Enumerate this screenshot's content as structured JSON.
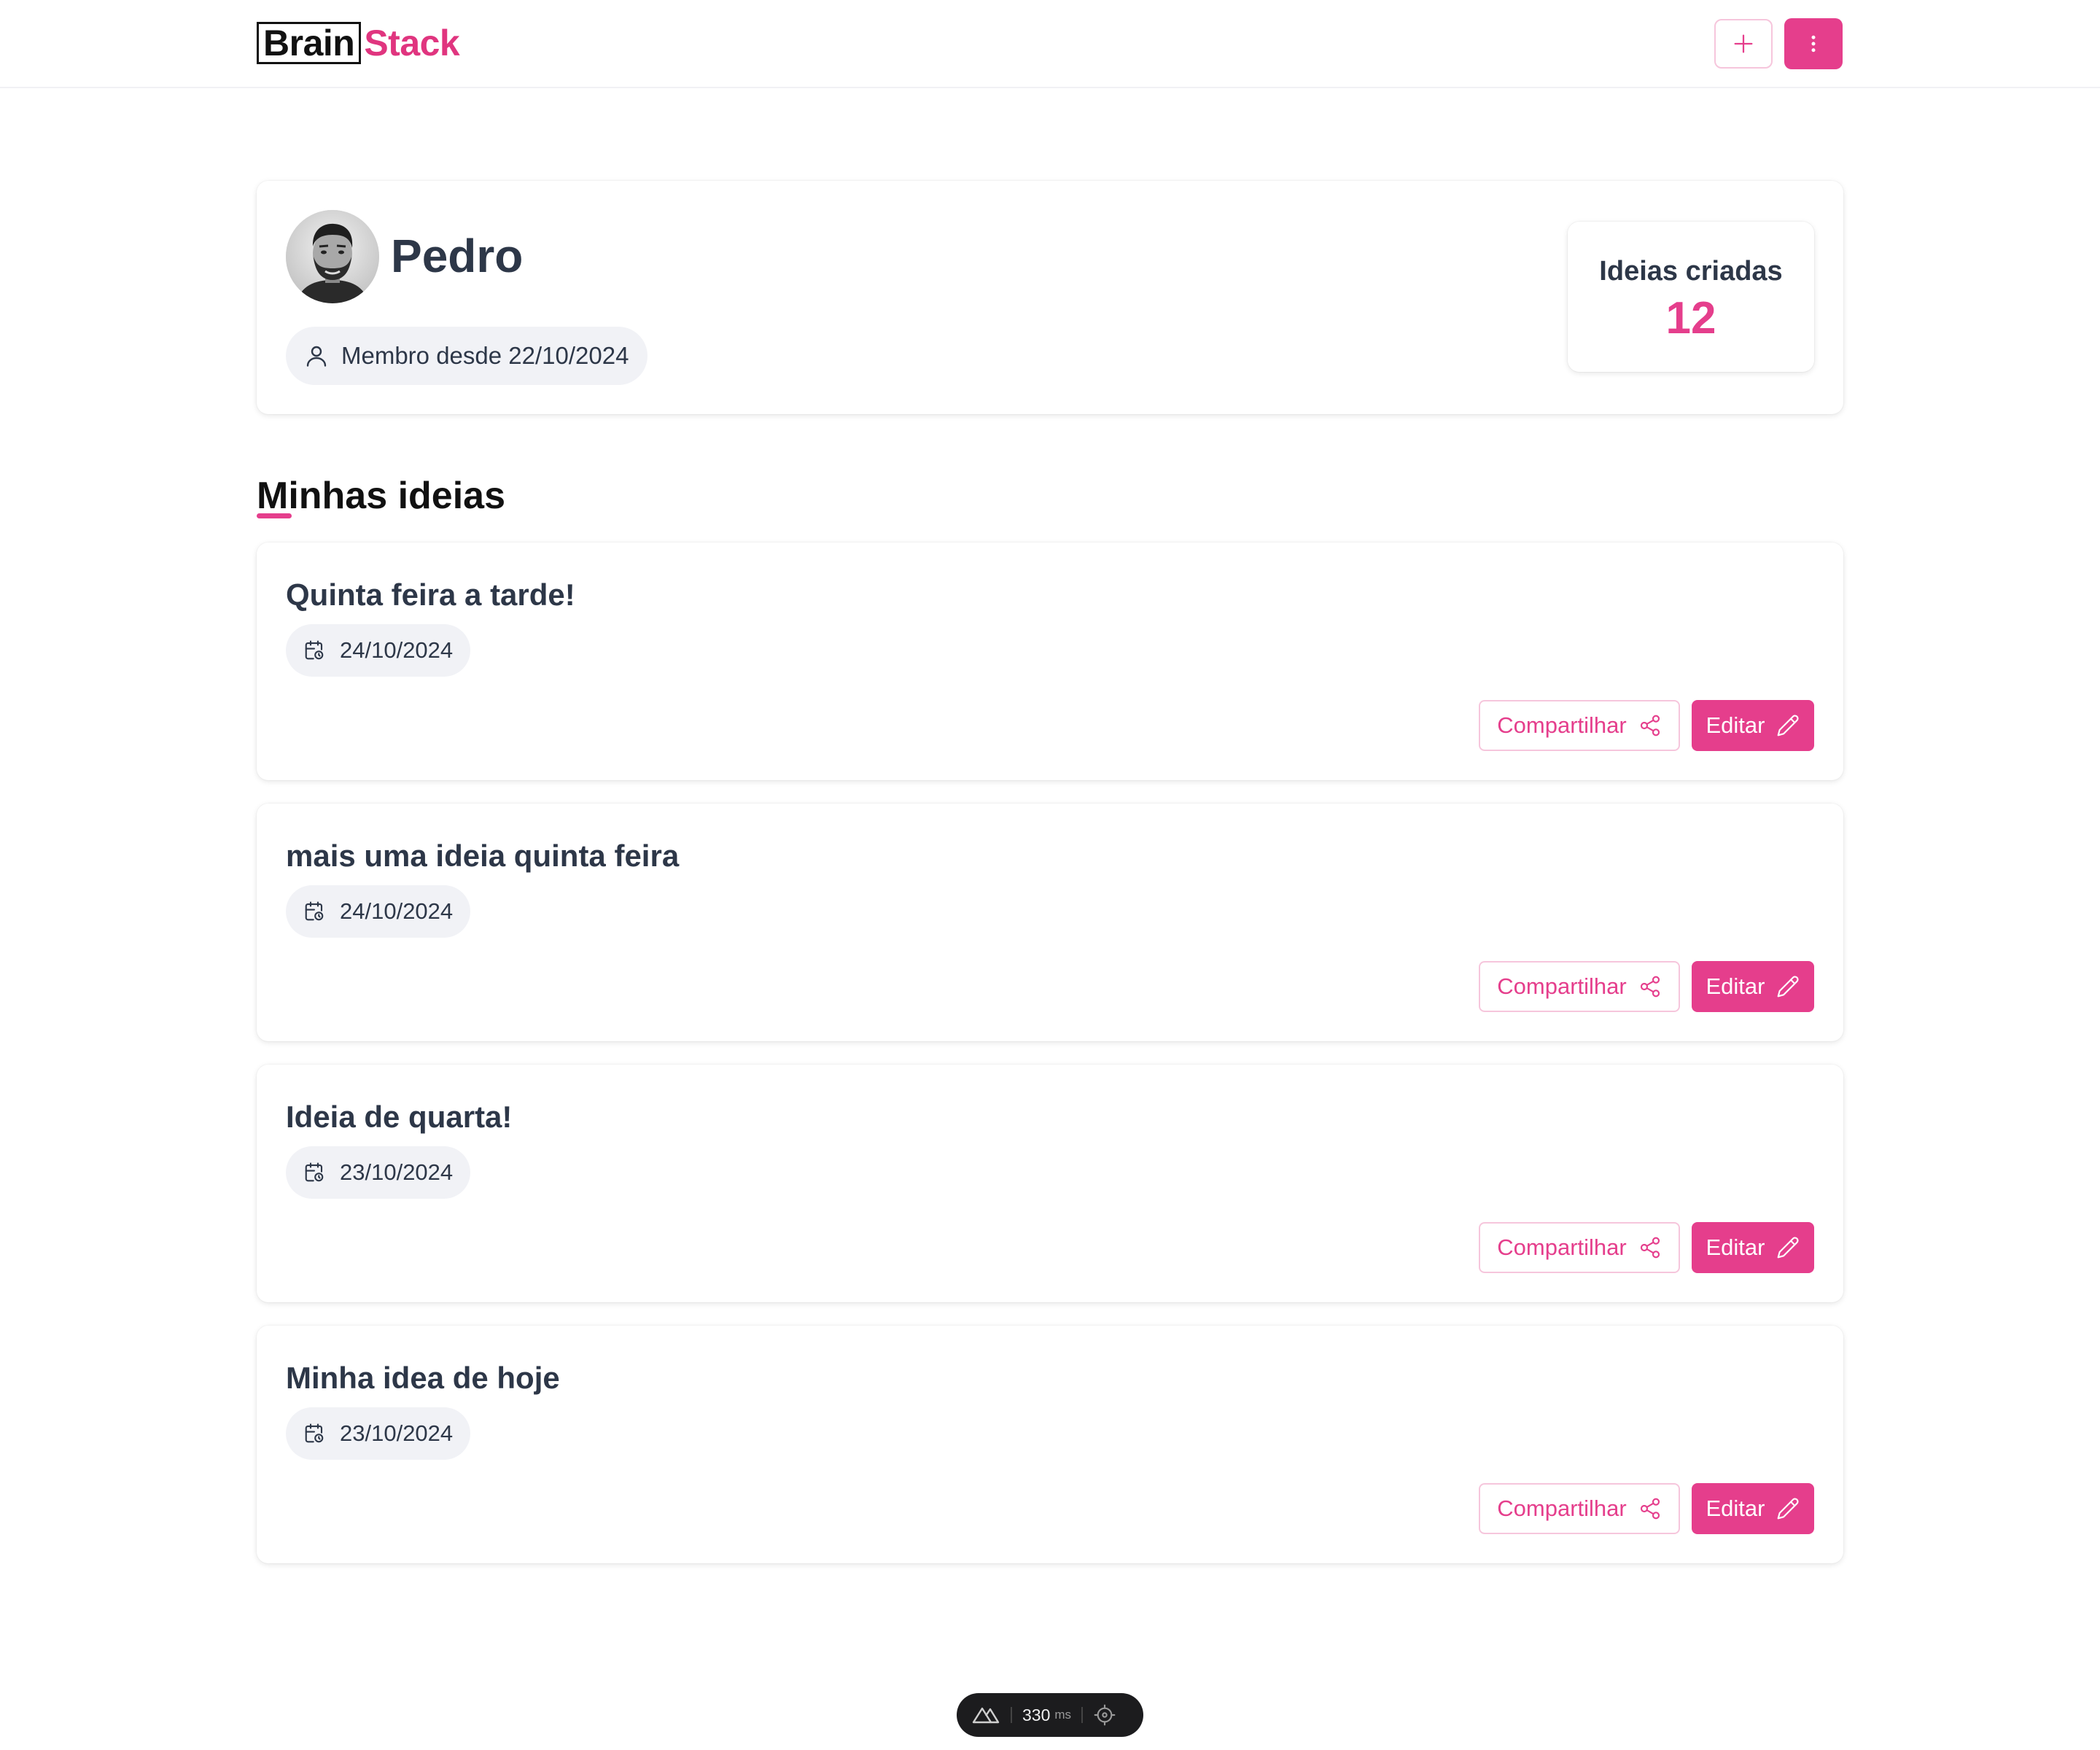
{
  "header": {
    "logo_part1": "Brain",
    "logo_part2": "Stack",
    "add_icon": "plus-icon",
    "menu_icon": "vertical-dots-icon"
  },
  "profile": {
    "name": "Pedro",
    "member_since": "Membro desde 22/10/2024",
    "stat_label": "Ideias criadas",
    "stat_value": "12"
  },
  "section": {
    "title": "Minhas ideias"
  },
  "ideas": [
    {
      "title": "Quinta feira a tarde!",
      "date": "24/10/2024",
      "share_label": "Compartilhar",
      "edit_label": "Editar"
    },
    {
      "title": "mais uma ideia quinta feira",
      "date": "24/10/2024",
      "share_label": "Compartilhar",
      "edit_label": "Editar"
    },
    {
      "title": "Ideia de quarta!",
      "date": "23/10/2024",
      "share_label": "Compartilhar",
      "edit_label": "Editar"
    },
    {
      "title": "Minha idea de hoje",
      "date": "23/10/2024",
      "share_label": "Compartilhar",
      "edit_label": "Editar"
    }
  ],
  "devtools": {
    "time_value": "330",
    "time_unit": "ms"
  },
  "colors": {
    "accent": "#e53e8c",
    "logo_accent": "#e0357f",
    "text": "#2d3748",
    "pill_bg": "#f1f2f6"
  }
}
